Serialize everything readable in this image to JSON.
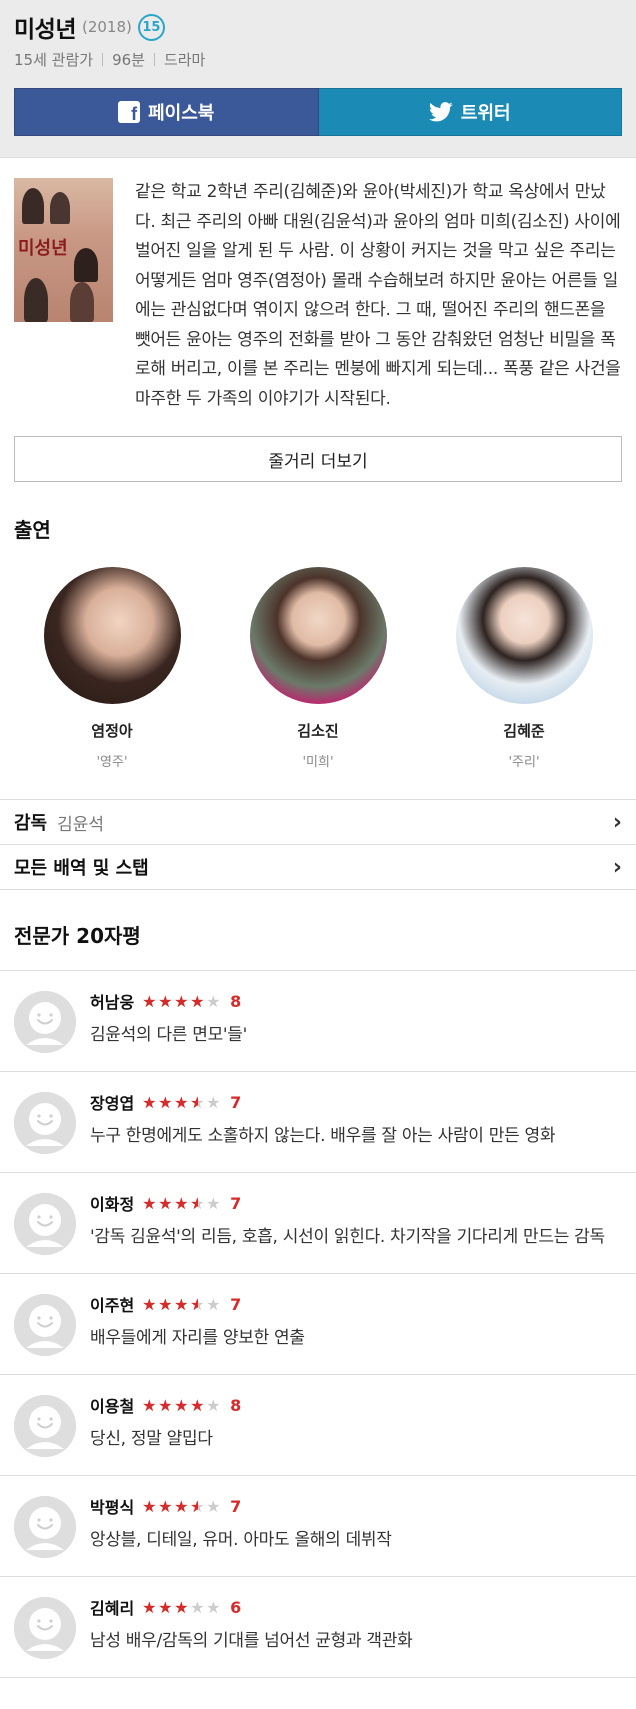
{
  "movie": {
    "title": "미성년",
    "year": "(2018)",
    "age_badge": "15",
    "rating": "15세 관람가",
    "runtime": "96분",
    "genre": "드라마"
  },
  "share": {
    "facebook_label": "페이스북",
    "twitter_label": "트위터"
  },
  "poster": {
    "title_text": "미성년"
  },
  "synopsis": "같은 학교 2학년 주리(김혜준)와 윤아(박세진)가 학교 옥상에서 만났다. 최근 주리의 아빠 대원(김윤석)과 윤아의 엄마 미희(김소진) 사이에 벌어진 일을 알게 된 두 사람. 이 상황이 커지는 것을 막고 싶은 주리는 어떻게든 엄마 영주(염정아) 몰래 수습해보려 하지만 윤아는 어른들 일에는 관심없다며 엮이지 않으려 한다. 그 때, 떨어진 주리의 핸드폰을 뺏어든 윤아는 영주의 전화를 받아 그 동안 감춰왔던 엄청난 비밀을 폭로해 버리고, 이를 본 주리는 멘붕에 빠지게 되는데... 폭풍 같은 사건을 마주한 두 가족의 이야기가 시작된다.",
  "more_label": "줄거리 더보기",
  "cast_section": {
    "title": "출연",
    "members": [
      {
        "name": "염정아",
        "role": "'영주'"
      },
      {
        "name": "김소진",
        "role": "'미희'"
      },
      {
        "name": "김혜준",
        "role": "'주리'"
      }
    ]
  },
  "director": {
    "label": "감독",
    "name": "김윤석"
  },
  "all_credits_label": "모든 배역 및 스탭",
  "critics": {
    "title": "전문가 20자평",
    "reviews": [
      {
        "name": "허남웅",
        "stars": 4,
        "score": "8",
        "text": "김윤석의 다른 면모'들'"
      },
      {
        "name": "장영엽",
        "stars": 3.5,
        "score": "7",
        "text": "누구 한명에게도 소홀하지 않는다. 배우를 잘 아는 사람이 만든 영화"
      },
      {
        "name": "이화정",
        "stars": 3.5,
        "score": "7",
        "text": "'감독 김윤석'의 리듬, 호흡, 시선이 읽힌다. 차기작을 기다리게 만드는 감독"
      },
      {
        "name": "이주현",
        "stars": 3.5,
        "score": "7",
        "text": "배우들에게 자리를 양보한 연출"
      },
      {
        "name": "이용철",
        "stars": 4,
        "score": "8",
        "text": "당신, 정말 얄밉다"
      },
      {
        "name": "박평식",
        "stars": 3.5,
        "score": "7",
        "text": "앙상블, 디테일, 유머. 아마도 올해의 데뷔작"
      },
      {
        "name": "김혜리",
        "stars": 3,
        "score": "6",
        "text": "남성 배우/감독의 기대를 넘어선 균형과 객관화"
      }
    ]
  },
  "colors": {
    "facebook": "#3b5998",
    "twitter": "#1b8ab5",
    "star_active": "#d62b2b",
    "age_badge": "#2aa6c9"
  }
}
